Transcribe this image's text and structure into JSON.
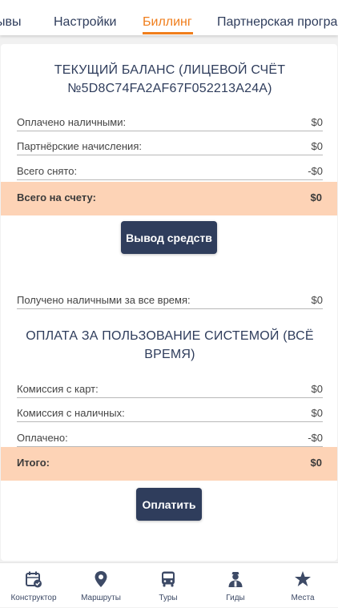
{
  "tabs": [
    "ывы",
    "Настройки",
    "Биллинг",
    "Партнерская програ"
  ],
  "active_tab": "Биллинг",
  "balance": {
    "title": "ТЕКУЩИЙ БАЛАНС (ЛИЦЕВОЙ СЧЁТ №5D8C74FA2AF67F052213A24A)",
    "rows": [
      {
        "label": "Оплачено наличными:",
        "value": "$0"
      },
      {
        "label": "Партнёрские начисления:",
        "value": "$0"
      },
      {
        "label": "Всего снято:",
        "value": "-$0"
      }
    ],
    "total": {
      "label": "Всего на счету:",
      "value": "$0"
    },
    "withdraw_button": "Вывод средств"
  },
  "received_row": {
    "label": "Получено наличными за все время:",
    "value": "$0"
  },
  "system_fee": {
    "title": "ОПЛАТА ЗА ПОЛЬЗОВАНИЕ СИСТЕМОЙ (ВСЁ ВРЕМЯ)",
    "rows": [
      {
        "label": "Комиссия с карт:",
        "value": "$0"
      },
      {
        "label": "Комиссия с наличных:",
        "value": "$0"
      },
      {
        "label": "Оплачено:",
        "value": "-$0"
      }
    ],
    "total": {
      "label": "Итого:",
      "value": "$0"
    },
    "pay_button": "Оплатить"
  },
  "bottom_nav": [
    {
      "label": "Конструктор",
      "icon": "calendar-check-icon"
    },
    {
      "label": "Маршруты",
      "icon": "map-pin-icon"
    },
    {
      "label": "Туры",
      "icon": "bus-icon"
    },
    {
      "label": "Гиды",
      "icon": "guide-person-icon"
    },
    {
      "label": "Места",
      "icon": "star-icon"
    }
  ],
  "colors": {
    "accent": "#f07e1c",
    "primary": "#2f3d5c",
    "total_highlight": "#fdd3b6"
  }
}
